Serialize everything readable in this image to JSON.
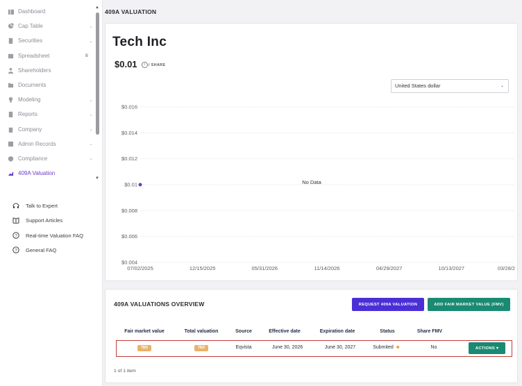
{
  "sidebar": {
    "items": [
      {
        "label": "Dashboard",
        "icon": "dashboard-icon",
        "chevron": false
      },
      {
        "label": "Cap Table",
        "icon": "pie-chart-icon",
        "chevron": true
      },
      {
        "label": "Securities",
        "icon": "document-icon",
        "chevron": true
      },
      {
        "label": "Spreadsheet",
        "icon": "spreadsheet-icon",
        "chevron": false,
        "badge": "crown-icon"
      },
      {
        "label": "Shareholders",
        "icon": "person-icon",
        "chevron": false
      },
      {
        "label": "Documents",
        "icon": "folder-icon",
        "chevron": false
      },
      {
        "label": "Modeling",
        "icon": "bulb-icon",
        "chevron": true
      },
      {
        "label": "Reports",
        "icon": "reports-icon",
        "chevron": true
      },
      {
        "label": "Company",
        "icon": "building-icon",
        "chevron": true
      },
      {
        "label": "Admin Records",
        "icon": "records-icon",
        "chevron": true
      },
      {
        "label": "Compliance",
        "icon": "shield-icon",
        "chevron": true
      },
      {
        "label": "409A Valuation",
        "icon": "valuation-icon",
        "chevron": false,
        "active": true
      }
    ],
    "support": [
      {
        "label": "Talk to Expert",
        "icon": "headset-icon"
      },
      {
        "label": "Support Articles",
        "icon": "book-icon"
      },
      {
        "label": "Real-time Valuation FAQ",
        "icon": "question-icon"
      },
      {
        "label": "General FAQ",
        "icon": "question-icon"
      }
    ]
  },
  "page": {
    "title": "409A VALUATION",
    "company": "Tech Inc",
    "price": "$0.01",
    "per_share": "/ SHARE",
    "currency": "United States dollar"
  },
  "chart_data": {
    "type": "line",
    "y_tick_labels": [
      "$0.016",
      "$0.014",
      "$0.012",
      "$0.01",
      "$0.008",
      "$0.006",
      "$0.004"
    ],
    "y_ticks": [
      0.016,
      0.014,
      0.012,
      0.01,
      0.008,
      0.006,
      0.004
    ],
    "ylim": [
      0.004,
      0.016
    ],
    "x_tick_labels": [
      "07/02/2025",
      "12/15/2025",
      "05/31/2026",
      "11/14/2026",
      "04/29/2027",
      "10/13/2027",
      "03/28/2"
    ],
    "x": [
      "07/02/2025"
    ],
    "values": [
      0.01
    ],
    "empty_message": "No Data",
    "series_color": "#6a3ec9",
    "grid": true
  },
  "overview": {
    "title": "409A VALUATIONS OVERVIEW",
    "request_button": "REQUEST 409A VALUATION",
    "add_button": "ADD FAIR MARKET VALUE (FMV)",
    "columns": [
      "Fair market value",
      "Total valuation",
      "Source",
      "Effective date",
      "Expiration date",
      "Status",
      "Share FMV"
    ],
    "row": {
      "fair_market_value": "TBD",
      "total_valuation": "TBD",
      "source": "Eqvista",
      "effective_date": "June 30, 2026",
      "expiration_date": "June 30, 2027",
      "status": "Submited",
      "share_fmv": "No"
    },
    "actions_button": "ACTIONS",
    "pager": "1 of 1 item"
  },
  "colors": {
    "accent": "#6a3ec9",
    "request_button": "#4b2fd6",
    "add_button": "#1a8a72",
    "tbd_badge": "#e9b26a",
    "highlight_border": "#c23b3b"
  }
}
